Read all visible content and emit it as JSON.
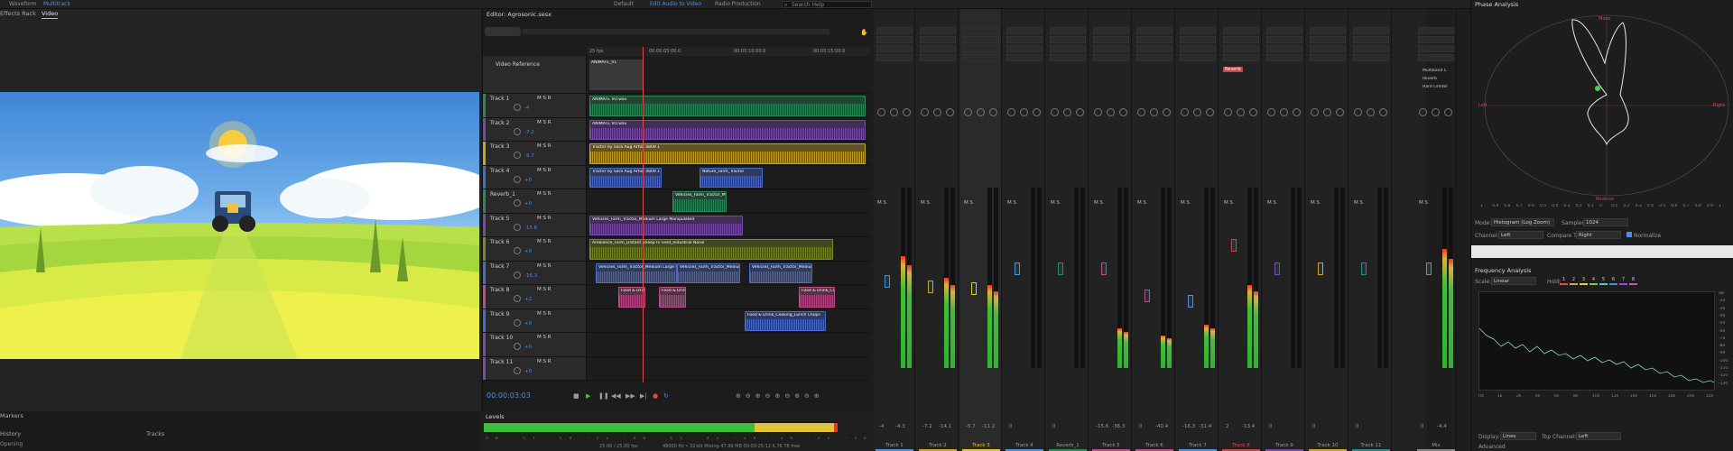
{
  "topbar": {
    "left_items": [
      "Waveform",
      "Multitrack"
    ],
    "workspaces": [
      "Default",
      "Edit Audio to Video",
      "Radio Production"
    ],
    "active_workspace": "Edit Audio to Video",
    "search_placeholder": "Search Help"
  },
  "video_panel": {
    "tabs": [
      "Effects Rack",
      "Video"
    ],
    "active_tab": "Video",
    "bottom_tabs": [
      "Markers",
      "History",
      "Tracks"
    ],
    "status": "Opening"
  },
  "editor": {
    "title": "Editor: Agrosonic.sesx",
    "timecode": "00:00:03:03",
    "ruler": [
      "25 fps",
      "00:00:05:00.0",
      "00:00:10:00.0",
      "00:00:15:00.0"
    ],
    "video_reference_label": "Video Reference",
    "video_clip_label": "ANIMATE_V1",
    "tracks": [
      {
        "name": "Track 1",
        "vol": "-4"
      },
      {
        "name": "Track 2",
        "vol": "-7.2"
      },
      {
        "name": "Track 3",
        "vol": "-5.7"
      },
      {
        "name": "Track 4",
        "vol": "+0"
      },
      {
        "name": "Reverb_1",
        "vol": "+0"
      },
      {
        "name": "Track 5",
        "vol": "-15.6"
      },
      {
        "name": "Track 6",
        "vol": "+0"
      },
      {
        "name": "Track 7",
        "vol": "-16.3"
      },
      {
        "name": "Track 8",
        "vol": "+2"
      },
      {
        "name": "Track 9",
        "vol": "+0"
      },
      {
        "name": "Track 10",
        "vol": "+0"
      },
      {
        "name": "Track 11",
        "vol": "+0"
      }
    ],
    "clips": {
      "animate_vo": "ANIMATE VO.wav",
      "tractor": "Tractor by Sara Aug Artist 4809 1",
      "ambience": "Ambience_Farm_Distant Sheep In Field_Industrial Noise",
      "vehicles": "Vehicles_Farm_Tractor_Medium Large Manipulated",
      "food": "Food & Drink_Cooking_Lunch Chops",
      "nature": "Nature_Farm_Tractor",
      "pan": "Pan"
    }
  },
  "levels": {
    "title": "Levels",
    "status": "48000 Hz • 32-bit Mixing   47.99 MB   00:00:25:12   6.76 TB free",
    "time": "25.00 / 25.00 fps"
  },
  "mixer": {
    "strips": [
      {
        "name": "Track 1",
        "meter": 0.62,
        "fader": 0.48,
        "db_left": "-4",
        "db_right": "-4.3"
      },
      {
        "name": "Track 2",
        "meter": 0.5,
        "fader": 0.45,
        "db_left": "-7.2",
        "db_right": "-14.1"
      },
      {
        "name": "Track 3",
        "meter": 0.46,
        "fader": 0.44,
        "db_left": "-5.7",
        "db_right": "-11.2"
      },
      {
        "name": "Track 4",
        "meter": 0.0,
        "fader": 0.55,
        "db_left": "0",
        "db_right": ""
      },
      {
        "name": "Reverb_1",
        "meter": 0.0,
        "fader": 0.55,
        "db_left": "0",
        "db_right": ""
      },
      {
        "name": "Track 5",
        "meter": 0.22,
        "fader": 0.55,
        "db_left": "-15.6",
        "db_right": "-36.3"
      },
      {
        "name": "Track 6",
        "meter": 0.18,
        "fader": 0.4,
        "db_left": "0",
        "db_right": "-40.4"
      },
      {
        "name": "Track 7",
        "meter": 0.24,
        "fader": 0.37,
        "db_left": "-16.3",
        "db_right": "-31.4"
      },
      {
        "name": "Track 8",
        "meter": 0.46,
        "fader": 0.68,
        "db_left": "2",
        "db_right": "-13.4"
      },
      {
        "name": "Track 9",
        "meter": 0.0,
        "fader": 0.55,
        "db_left": "0",
        "db_right": ""
      },
      {
        "name": "Track 10",
        "meter": 0.0,
        "fader": 0.55,
        "db_left": "0",
        "db_right": ""
      },
      {
        "name": "Track 11",
        "meter": 0.0,
        "fader": 0.55,
        "db_left": "0",
        "db_right": ""
      },
      {
        "name": "Mix",
        "meter": 0.66,
        "fader": 0.55,
        "db_left": "0",
        "db_right": "-4.4"
      }
    ],
    "reverb_label": "Reverb",
    "fx_labels": [
      "Multiband C",
      "Reverb",
      "Hard Limiter"
    ]
  },
  "phase": {
    "title": "Phase Analysis",
    "labels": {
      "top": "Mono",
      "left": "Left",
      "right": "Right",
      "bottom": "Reverse"
    },
    "mode_label": "Mode:",
    "mode": "Histogram (Log Zoom)",
    "samples_label": "Samples:",
    "samples": "1024",
    "channel_label": "Channel:",
    "channel": "Left",
    "compare_label": "Compare To:",
    "compare": "Right",
    "normalize": "Normalize",
    "ticks": [
      "1",
      "0.9",
      "0.8",
      "0.7",
      "0.6",
      "0.5",
      "0.4",
      "0.3",
      "0.2",
      "0.1",
      "0",
      "0.1",
      "0.2",
      "0.3",
      "0.4",
      "0.5",
      "0.6",
      "0.7",
      "0.8",
      "0.9",
      "1"
    ]
  },
  "freq": {
    "title": "Frequency Analysis",
    "scale_label": "Scale:",
    "scale": "Linear",
    "hold_label": "Hold:",
    "holds": [
      "1",
      "2",
      "3",
      "4",
      "5",
      "6",
      "7",
      "8"
    ],
    "hold_colors": [
      "#e04b4b",
      "#e0a04b",
      "#e0d44b",
      "#6fd04b",
      "#4bd0c0",
      "#4b8fe0",
      "#a04be0",
      "#e04bb0"
    ],
    "x_ticks": [
      "Hz",
      "1k",
      "2k",
      "4k",
      "6k",
      "8k",
      "10k",
      "12k",
      "14k",
      "16k",
      "18k",
      "20k",
      "22k"
    ],
    "y_ticks": [
      "dB",
      "-20",
      "-30",
      "-40",
      "-50",
      "-60",
      "-70",
      "-80",
      "-90",
      "-100",
      "-110",
      "-120",
      "-130"
    ],
    "display_label": "Display:",
    "display": "Lines",
    "top_channel_label": "Top Channel:",
    "top_channel": "Left",
    "advanced": "Advanced"
  },
  "colors": {
    "accent": "#4d8fe0",
    "track_green": "#2a8a5a",
    "track_purple": "#7a4aa8",
    "track_yellow": "#c9a52a",
    "track_pink": "#c04a8a",
    "track_blue": "#4a6ac8",
    "track_teal": "#2a8a8a"
  }
}
